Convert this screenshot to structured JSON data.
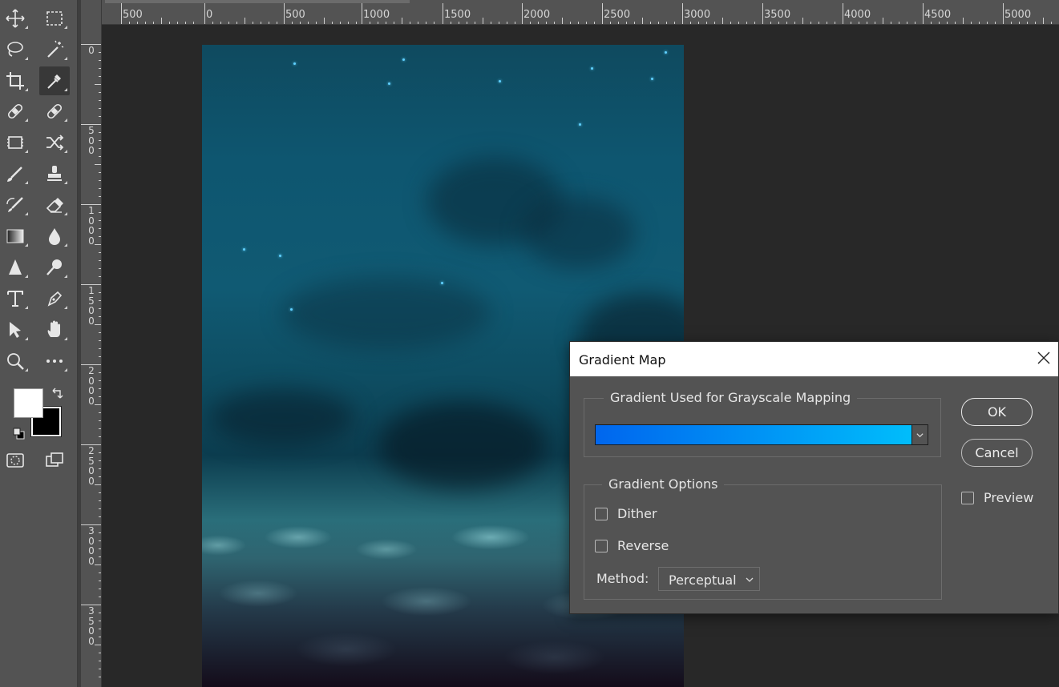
{
  "toolbar": {
    "tools": [
      {
        "name": "move-tool",
        "icon": "move-icon",
        "active": false
      },
      {
        "name": "marquee-tool",
        "icon": "rectangle-marquee-icon",
        "active": false
      },
      {
        "name": "lasso-tool",
        "icon": "lasso-icon",
        "active": false
      },
      {
        "name": "magic-wand-tool",
        "icon": "magic-wand-icon",
        "active": false
      },
      {
        "name": "crop-tool",
        "icon": "crop-icon",
        "active": false
      },
      {
        "name": "eyedropper-tool",
        "icon": "eyedropper-icon",
        "active": true
      },
      {
        "name": "spot-healing-tool",
        "icon": "bandage-icon",
        "active": false
      },
      {
        "name": "healing-brush-tool",
        "icon": "bandage-icon",
        "active": false
      },
      {
        "name": "patch-tool",
        "icon": "patch-icon",
        "active": false
      },
      {
        "name": "content-aware-move-tool",
        "icon": "shuffle-icon",
        "active": false
      },
      {
        "name": "brush-tool",
        "icon": "brush-icon",
        "active": false
      },
      {
        "name": "clone-stamp-tool",
        "icon": "stamp-icon",
        "active": false
      },
      {
        "name": "history-brush-tool",
        "icon": "history-brush-icon",
        "active": false
      },
      {
        "name": "eraser-tool",
        "icon": "eraser-icon",
        "active": false
      },
      {
        "name": "gradient-tool",
        "icon": "gradient-icon",
        "active": false
      },
      {
        "name": "blur-tool",
        "icon": "drop-icon",
        "active": false
      },
      {
        "name": "sharpen-tool",
        "icon": "triangle-icon",
        "active": false
      },
      {
        "name": "dodge-tool",
        "icon": "dodge-icon",
        "active": false
      },
      {
        "name": "type-tool",
        "icon": "type-icon",
        "active": false
      },
      {
        "name": "pen-tool",
        "icon": "pen-icon",
        "active": false
      },
      {
        "name": "path-selection-tool",
        "icon": "arrow-icon",
        "active": false
      },
      {
        "name": "hand-tool",
        "icon": "hand-icon",
        "active": false
      },
      {
        "name": "zoom-tool",
        "icon": "zoom-icon",
        "active": false
      },
      {
        "name": "more-tools",
        "icon": "ellipsis-icon",
        "active": false
      },
      {
        "name": "quick-mask-tool",
        "icon": "quick-mask-icon",
        "active": false
      },
      {
        "name": "screen-mode-tool",
        "icon": "screen-mode-icon",
        "active": false
      }
    ],
    "foreground_color": "#ffffff",
    "background_color": "#000000"
  },
  "ruler": {
    "top_labels": [
      "500",
      "0",
      "500",
      "1000",
      "1500",
      "2000",
      "2500",
      "3000",
      "3500",
      "4000",
      "4500",
      "5000"
    ],
    "left_labels": [
      [
        "0"
      ],
      [
        "5",
        "0",
        "0"
      ],
      [
        "1",
        "0",
        "0",
        "0"
      ],
      [
        "1",
        "5",
        "0",
        "0"
      ],
      [
        "2",
        "0",
        "0",
        "0"
      ],
      [
        "2",
        "5",
        "0",
        "0"
      ],
      [
        "3",
        "0",
        "0",
        "0"
      ],
      [
        "3",
        "5",
        "0",
        "0"
      ]
    ]
  },
  "dialog": {
    "title": "Gradient Map",
    "mapping_group_label": "Gradient Used for Grayscale Mapping",
    "gradient_start_color": "#0066ee",
    "gradient_end_color": "#00bdfb",
    "options_group_label": "Gradient Options",
    "dither_label": "Dither",
    "dither_checked": false,
    "reverse_label": "Reverse",
    "reverse_checked": false,
    "method_label": "Method:",
    "method_value": "Perceptual",
    "ok_label": "OK",
    "cancel_label": "Cancel",
    "preview_label": "Preview",
    "preview_checked": false
  }
}
